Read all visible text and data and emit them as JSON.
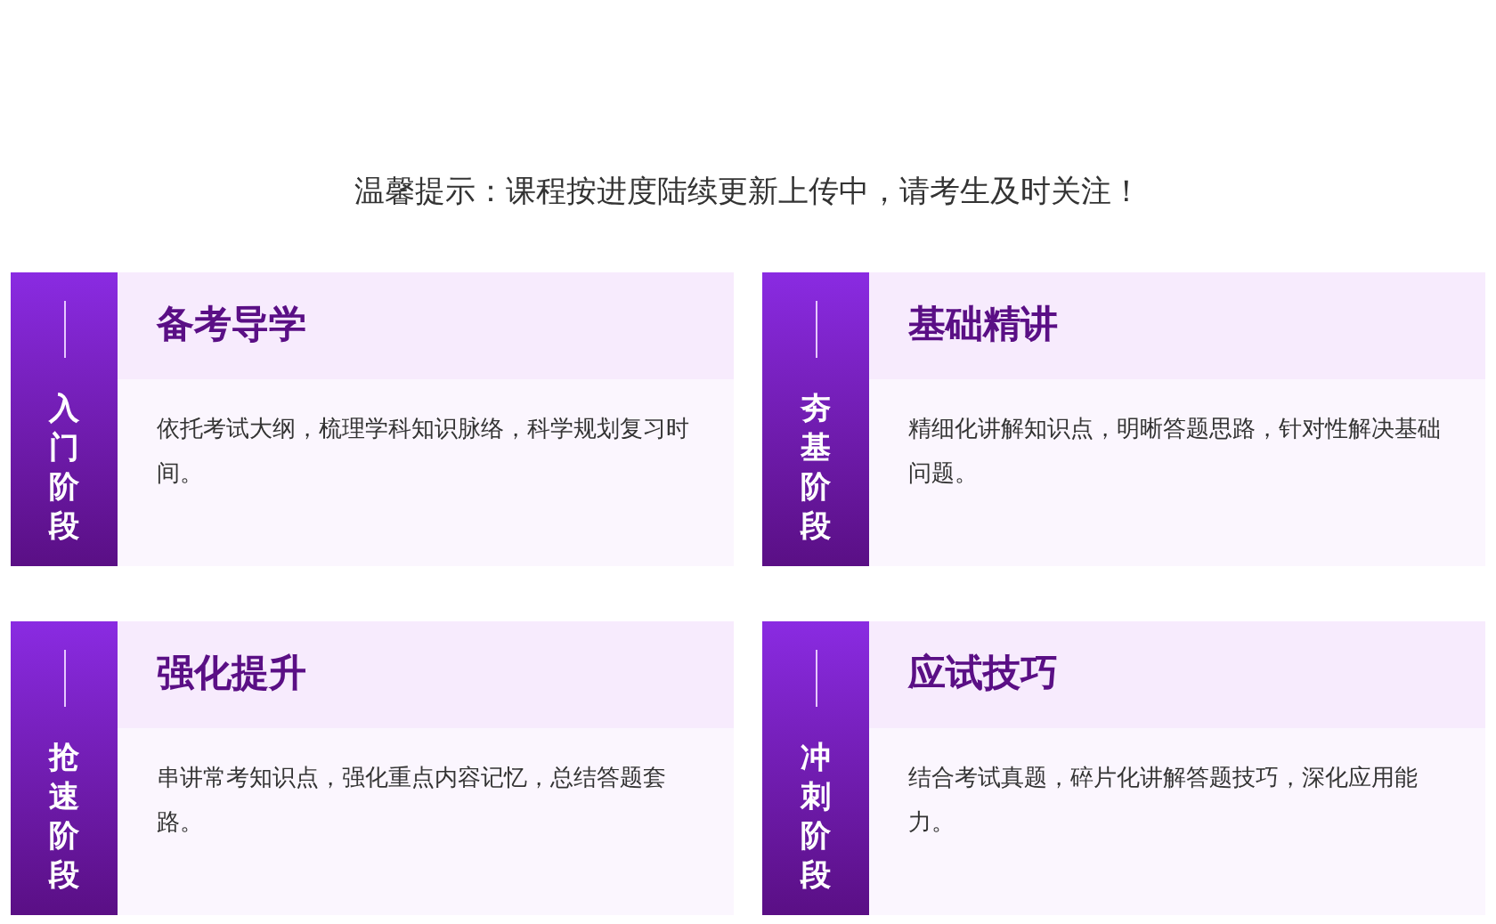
{
  "notice": "温馨提示：课程按进度陆续更新上传中，请考生及时关注！",
  "stages": [
    {
      "stage": "入门阶段",
      "title": "备考导学",
      "description": "依托考试大纲，梳理学科知识脉络，科学规划复习时间。"
    },
    {
      "stage": "夯基阶段",
      "title": "基础精讲",
      "description": "精细化讲解知识点，明晰答题思路，针对性解决基础问题。"
    },
    {
      "stage": "抢速阶段",
      "title": "强化提升",
      "description": "串讲常考知识点，强化重点内容记忆，总结答题套路。"
    },
    {
      "stage": "冲刺阶段",
      "title": "应试技巧",
      "description": "结合考试真题，碎片化讲解答题技巧，深化应用能力。"
    }
  ]
}
